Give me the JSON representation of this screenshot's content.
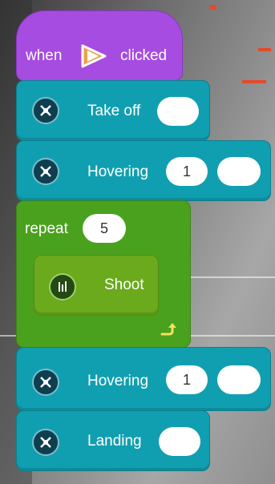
{
  "colors": {
    "event": "#a64ce0",
    "drone": "#109fb0",
    "control": "#4aa11e",
    "shoot": "#6aaa1c"
  },
  "event_block": {
    "prefix": "when",
    "icon": "play-icon",
    "suffix": "clicked"
  },
  "blocks": {
    "takeoff": {
      "label": "Take off",
      "icon": "drone-icon"
    },
    "hover1": {
      "label": "Hovering",
      "value": "1",
      "icon": "drone-icon"
    },
    "repeat": {
      "label": "repeat",
      "count": "5",
      "loop_icon": "loop-arrow-icon"
    },
    "shoot": {
      "label": "Shoot",
      "icon": "shoot-icon"
    },
    "hover2": {
      "label": "Hovering",
      "value": "1",
      "icon": "drone-icon"
    },
    "landing": {
      "label": "Landing",
      "icon": "drone-icon"
    }
  }
}
